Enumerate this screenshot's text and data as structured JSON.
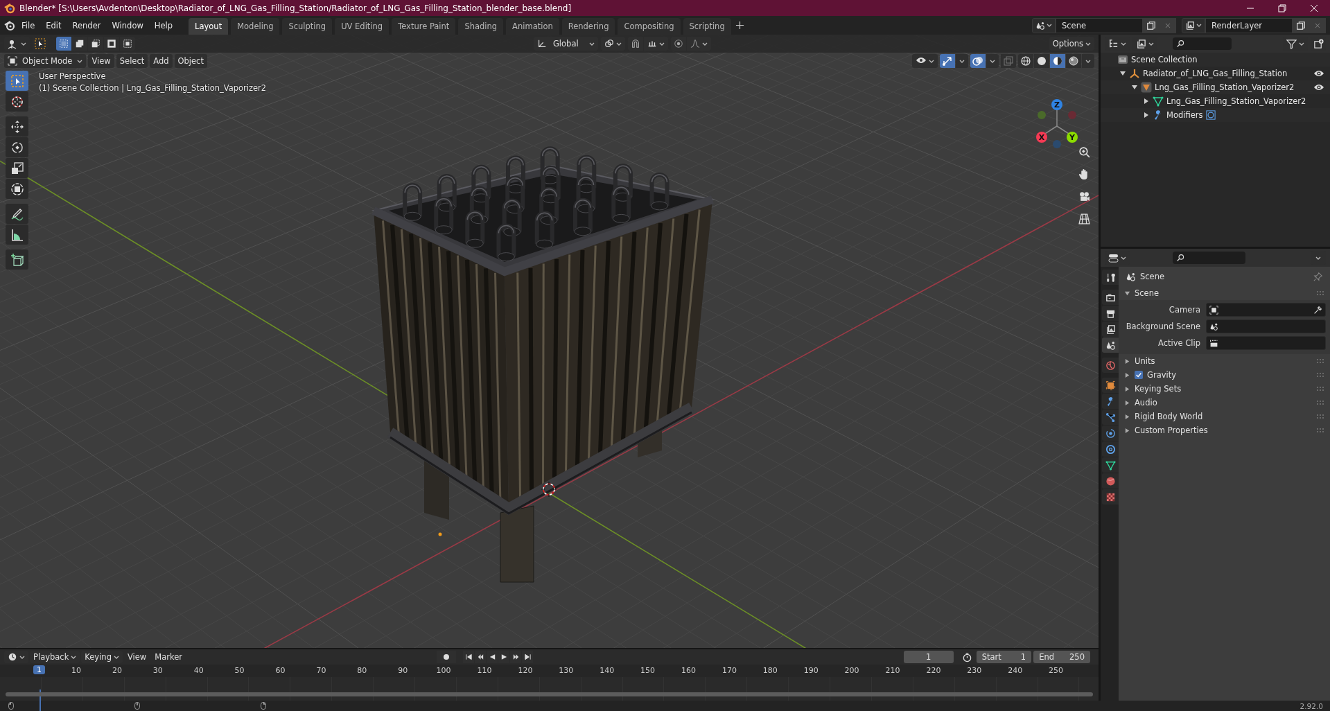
{
  "window": {
    "title": "Blender* [S:\\Users\\Avdenton\\Desktop\\Radiator_of_LNG_Gas_Filling_Station/Radiator_of_LNG_Gas_Filling_Station_blender_base.blend]"
  },
  "menu": [
    "File",
    "Edit",
    "Render",
    "Window",
    "Help"
  ],
  "workspaces": [
    {
      "label": "Layout",
      "selected": true
    },
    {
      "label": "Modeling",
      "selected": false
    },
    {
      "label": "Sculpting",
      "selected": false
    },
    {
      "label": "UV Editing",
      "selected": false
    },
    {
      "label": "Texture Paint",
      "selected": false
    },
    {
      "label": "Shading",
      "selected": false
    },
    {
      "label": "Animation",
      "selected": false
    },
    {
      "label": "Rendering",
      "selected": false
    },
    {
      "label": "Compositing",
      "selected": false
    },
    {
      "label": "Scripting",
      "selected": false
    }
  ],
  "scene": {
    "name": "Scene"
  },
  "view_layer": {
    "name": "RenderLayer"
  },
  "viewport": {
    "select_modes": [
      {
        "selected": true
      },
      {
        "selected": false
      },
      {
        "selected": false
      },
      {
        "selected": false
      },
      {
        "selected": false
      }
    ],
    "transform_orientation": "Global",
    "options": "Options",
    "mode": "Object Mode",
    "menus": [
      "View",
      "Select",
      "Add",
      "Object"
    ],
    "toggles": [
      {
        "kind": "gizmos",
        "on": true
      },
      {
        "kind": "overlays",
        "on": true
      },
      {
        "kind": "xray",
        "on": false
      }
    ],
    "shading": [
      {
        "kind": "wireframe",
        "selected": false
      },
      {
        "kind": "solid",
        "selected": false
      },
      {
        "kind": "material",
        "selected": true
      },
      {
        "kind": "rendered",
        "selected": false
      }
    ],
    "perspective": "User Perspective",
    "context": "(1) Scene Collection | Lng_Gas_Filling_Station_Vaporizer2",
    "tools": [
      {
        "kind": "select",
        "selected": true
      },
      {
        "kind": "cursor",
        "selected": false
      },
      {
        "kind": "move",
        "selected": false
      },
      {
        "kind": "rotate",
        "selected": false
      },
      {
        "kind": "scale",
        "selected": false
      },
      {
        "kind": "transform",
        "selected": false
      },
      {
        "kind": "annotate",
        "selected": false
      },
      {
        "kind": "measure",
        "selected": false
      },
      {
        "kind": "add_cube",
        "selected": false
      }
    ],
    "gizmo_axes": [
      {
        "label": "Z",
        "color": "#2f83e3"
      },
      {
        "label": "X",
        "color": "#f53a54"
      },
      {
        "label": "Y",
        "color": "#8bdc00"
      }
    ]
  },
  "outliner": {
    "tree": [
      {
        "label": "Scene Collection",
        "kind": "collection",
        "children": [
          {
            "label": "Radiator_of_LNG_Gas_Filling_Station",
            "kind": "empty",
            "expanded": true,
            "visible": true,
            "children": [
              {
                "label": "Lng_Gas_Filling_Station_Vaporizer2",
                "kind": "mesh_object",
                "expanded": true,
                "visible": true,
                "children": [
                  {
                    "label": "Lng_Gas_Filling_Station_Vaporizer2",
                    "kind": "mesh_data",
                    "expanded": false,
                    "visible": false
                  },
                  {
                    "label": "Modifiers",
                    "kind": "modifiers",
                    "expanded": false,
                    "visible": false
                  }
                ]
              }
            ]
          }
        ]
      }
    ]
  },
  "properties": {
    "tabs": [
      {
        "kind": "tool",
        "selected": false
      },
      {
        "kind": "render",
        "selected": false
      },
      {
        "kind": "output",
        "selected": false
      },
      {
        "kind": "view_layer",
        "selected": false
      },
      {
        "kind": "scene",
        "selected": true
      },
      {
        "kind": "world",
        "selected": false
      },
      {
        "kind": "object",
        "selected": false
      },
      {
        "kind": "modifiers",
        "selected": false
      },
      {
        "kind": "particles",
        "selected": false
      },
      {
        "kind": "physics",
        "selected": false
      },
      {
        "kind": "constraints",
        "selected": false
      },
      {
        "kind": "data",
        "selected": false
      },
      {
        "kind": "material",
        "selected": false
      },
      {
        "kind": "texture",
        "selected": false
      }
    ],
    "context": "Scene",
    "panels": [
      {
        "title": "Scene",
        "expanded": true,
        "fields": [
          {
            "label": "Camera",
            "kind": "camera"
          },
          {
            "label": "Background Scene",
            "kind": "scene"
          },
          {
            "label": "Active Clip",
            "kind": "clip"
          }
        ]
      },
      {
        "title": "Units",
        "expanded": false
      },
      {
        "title": "Gravity",
        "expanded": false,
        "checked": true
      },
      {
        "title": "Keying Sets",
        "expanded": false
      },
      {
        "title": "Audio",
        "expanded": false
      },
      {
        "title": "Rigid Body World",
        "expanded": false
      },
      {
        "title": "Custom Properties",
        "expanded": false
      }
    ]
  },
  "timeline": {
    "menus": [
      {
        "label": "Playback",
        "dropdown": true
      },
      {
        "label": "Keying",
        "dropdown": true
      },
      {
        "label": "View",
        "dropdown": false
      },
      {
        "label": "Marker",
        "dropdown": false
      }
    ],
    "current_frame": "1",
    "start": {
      "label": "Start",
      "value": "1"
    },
    "end": {
      "label": "End",
      "value": "250"
    },
    "playhead": "1",
    "frame_labels": [
      "10",
      "20",
      "30",
      "40",
      "50",
      "60",
      "70",
      "80",
      "90",
      "100",
      "110",
      "120",
      "130",
      "140",
      "150",
      "160",
      "170",
      "180",
      "190",
      "200",
      "210",
      "220",
      "230",
      "240",
      "250"
    ]
  },
  "status_bar": {
    "version": "2.92.0"
  }
}
